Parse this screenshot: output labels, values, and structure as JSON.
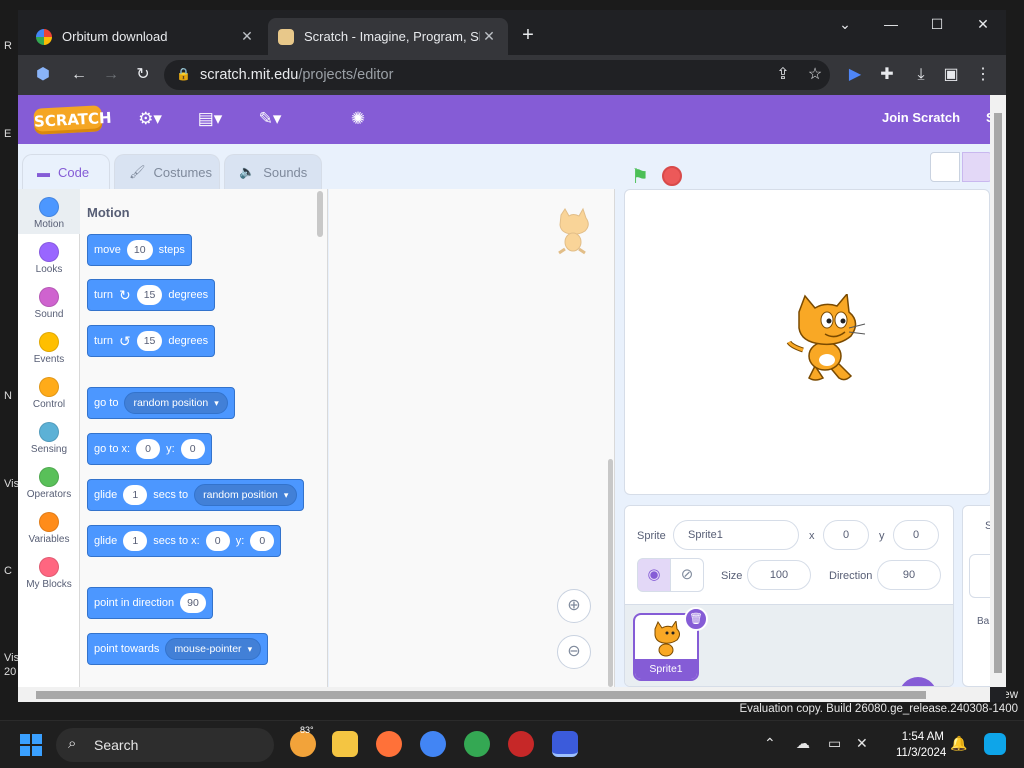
{
  "desktop": {
    "edge_glyphs": [
      "R",
      "E",
      "N",
      "Vis",
      "C",
      "Vis",
      "20"
    ],
    "eval_line1": "ew",
    "eval_line2": "Evaluation copy. Build 26080.ge_release.240308-1400"
  },
  "browser": {
    "tabs": [
      {
        "title": "Orbitum download",
        "active": false
      },
      {
        "title": "Scratch - Imagine, Program, Sha",
        "active": true
      }
    ],
    "url_host": "scratch.mit.edu",
    "url_path": "/projects/editor"
  },
  "scratch": {
    "menu": {
      "join": "Join Scratch",
      "signin_edge": "S"
    },
    "editor_tabs": {
      "code": "Code",
      "costumes": "Costumes",
      "sounds": "Sounds"
    },
    "categories": [
      {
        "label": "Motion",
        "color": "#4c97ff"
      },
      {
        "label": "Looks",
        "color": "#9966ff"
      },
      {
        "label": "Sound",
        "color": "#cf63cf"
      },
      {
        "label": "Events",
        "color": "#ffbf00"
      },
      {
        "label": "Control",
        "color": "#ffab19"
      },
      {
        "label": "Sensing",
        "color": "#5cb1d6"
      },
      {
        "label": "Operators",
        "color": "#59c059"
      },
      {
        "label": "Variables",
        "color": "#ff8c1a"
      },
      {
        "label": "My Blocks",
        "color": "#ff6680"
      }
    ],
    "palette": {
      "title": "Motion",
      "move": {
        "a": "move",
        "n": "10",
        "b": "steps"
      },
      "turn_right": {
        "a": "turn",
        "n": "15",
        "b": "degrees"
      },
      "turn_left": {
        "a": "turn",
        "n": "15",
        "b": "degrees"
      },
      "goto": {
        "a": "go to",
        "opt": "random position"
      },
      "goto_xy": {
        "a": "go to x:",
        "x": "0",
        "ylab": "y:",
        "y": "0"
      },
      "glide_to": {
        "a": "glide",
        "n": "1",
        "b": "secs to",
        "opt": "random position"
      },
      "glide_xy": {
        "a": "glide",
        "n": "1",
        "b": "secs to x:",
        "x": "0",
        "ylab": "y:",
        "y": "0"
      },
      "point_dir": {
        "a": "point in direction",
        "n": "90"
      },
      "point_towards": {
        "a": "point towards",
        "opt": "mouse-pointer"
      }
    },
    "sprite_info": {
      "sprite_label": "Sprite",
      "sprite_name": "Sprite1",
      "x_label": "x",
      "x": "0",
      "y_label": "y",
      "y": "0",
      "size_label": "Size",
      "size": "100",
      "direction_label": "Direction",
      "direction": "90"
    },
    "sprites": [
      {
        "name": "Sprite1"
      }
    ],
    "stage_panel": {
      "label": "S",
      "backdrops": "Ba"
    }
  },
  "taskbar": {
    "search": "Search",
    "weather_temp": "83°",
    "time": "1:54 AM",
    "date": "11/3/2024"
  }
}
